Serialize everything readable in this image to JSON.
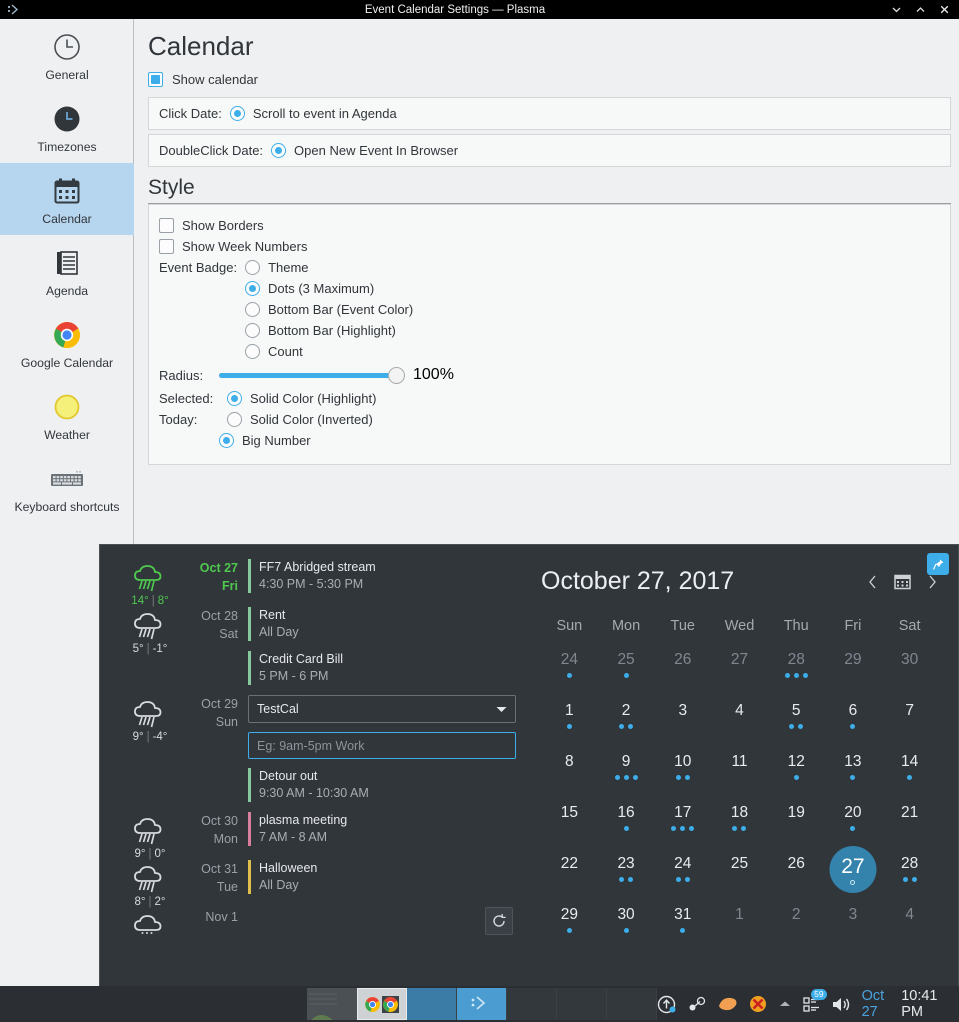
{
  "window": {
    "title": "Event Calendar Settings — Plasma",
    "app_icon": "plasma-icon",
    "minimize_label": "Minimize",
    "maximize_label": "Maximize",
    "close_label": "Close"
  },
  "sidebar": {
    "items": [
      {
        "label": "General",
        "icon": "clock-icon",
        "selected": false
      },
      {
        "label": "Timezones",
        "icon": "timezone-clock-icon",
        "selected": false
      },
      {
        "label": "Calendar",
        "icon": "calendar-icon",
        "selected": true
      },
      {
        "label": "Agenda",
        "icon": "agenda-list-icon",
        "selected": false
      },
      {
        "label": "Google Calendar",
        "icon": "chrome-icon",
        "selected": false
      },
      {
        "label": "Weather",
        "icon": "sun-icon",
        "selected": false
      },
      {
        "label": "Keyboard shortcuts",
        "icon": "keyboard-icon",
        "selected": false
      }
    ]
  },
  "settings": {
    "page_title": "Calendar",
    "show_calendar": {
      "label": "Show calendar",
      "checked": true
    },
    "click_date": {
      "label": "Click Date:",
      "option": "Scroll to event in Agenda",
      "selected": true
    },
    "doubleclick_date": {
      "label": "DoubleClick Date:",
      "option": "Open New Event In Browser",
      "selected": true
    },
    "style_title": "Style",
    "show_borders": {
      "label": "Show Borders",
      "checked": false
    },
    "show_week_numbers": {
      "label": "Show Week Numbers",
      "checked": false
    },
    "event_badge": {
      "label": "Event Badge:",
      "options": [
        {
          "label": "Theme",
          "selected": false
        },
        {
          "label": "Dots (3 Maximum)",
          "selected": true
        },
        {
          "label": "Bottom Bar (Event Color)",
          "selected": false
        },
        {
          "label": "Bottom Bar (Highlight)",
          "selected": false
        },
        {
          "label": "Count",
          "selected": false
        }
      ]
    },
    "radius": {
      "label": "Radius:",
      "value": "100%",
      "percent": 100
    },
    "selected": {
      "label": "Selected:",
      "option": "Solid Color (Highlight)",
      "selected": true
    },
    "today": {
      "label": "Today:",
      "options": [
        {
          "label": "Solid Color (Inverted)",
          "selected": false
        },
        {
          "label": "Big Number",
          "selected": true
        }
      ]
    }
  },
  "popup": {
    "agenda": {
      "days": [
        {
          "date": "Oct 27",
          "weekday": "Fri",
          "today": true,
          "weather": {
            "icon": "rain-cloud-icon",
            "high": "14°",
            "low": "8°",
            "separator": "|"
          },
          "events": [
            {
              "title": "FF7 Abridged stream",
              "time": "4:30 PM - 5:30 PM",
              "color": "#88c9a0"
            }
          ]
        },
        {
          "date": "Oct 28",
          "weekday": "Sat",
          "today": false,
          "weather": {
            "icon": "rain-cloud-icon",
            "high": "5°",
            "low": "-1°",
            "separator": "|"
          },
          "events": [
            {
              "title": "Rent",
              "time": "All Day",
              "color": "#88c9a0"
            },
            {
              "title": "Credit Card Bill",
              "time": "5 PM - 6 PM",
              "color": "#88c9a0"
            }
          ]
        },
        {
          "date": "Oct 29",
          "weekday": "Sun",
          "today": false,
          "weather": {
            "icon": "rain-cloud-icon",
            "high": "9°",
            "low": "-4°",
            "separator": "|"
          },
          "new_event": {
            "calendar_value": "TestCal",
            "calendar_options": [
              "TestCal"
            ],
            "input_value": "",
            "input_placeholder": "Eg: 9am-5pm Work"
          },
          "events": [
            {
              "title": "Detour out",
              "time": "9:30 AM - 10:30 AM",
              "color": "#88c9a0"
            }
          ]
        },
        {
          "date": "Oct 30",
          "weekday": "Mon",
          "today": false,
          "weather": {
            "icon": "rain-cloud-icon",
            "high": "9°",
            "low": "0°",
            "separator": "|"
          },
          "events": [
            {
              "title": "plasma meeting",
              "time": "7 AM - 8 AM",
              "color": "#d97f9e"
            }
          ]
        },
        {
          "date": "Oct 31",
          "weekday": "Tue",
          "today": false,
          "weather": {
            "icon": "rain-cloud-icon",
            "high": "8°",
            "low": "2°",
            "separator": "|"
          },
          "events": [
            {
              "title": "Halloween",
              "time": "All Day",
              "color": "#e0c04a"
            }
          ]
        },
        {
          "date": "Nov 1",
          "weekday": "",
          "today": false,
          "weather": {
            "icon": "cloud-icon",
            "high": "",
            "low": "",
            "separator": ""
          },
          "events": []
        }
      ],
      "reload_button": "reload-icon"
    },
    "calendar": {
      "title": "October 27, 2017",
      "prev_label": "‹",
      "next_label": "›",
      "month_picker_icon": "calendar-icon",
      "pin_icon": "pin-icon",
      "day_headers": [
        "Sun",
        "Mon",
        "Tue",
        "Wed",
        "Thu",
        "Fri",
        "Sat"
      ],
      "weeks": [
        [
          {
            "day": "24",
            "out": true,
            "today": false,
            "dots": 1
          },
          {
            "day": "25",
            "out": true,
            "today": false,
            "dots": 1
          },
          {
            "day": "26",
            "out": true,
            "today": false,
            "dots": 0
          },
          {
            "day": "27",
            "out": true,
            "today": false,
            "dots": 0
          },
          {
            "day": "28",
            "out": true,
            "today": false,
            "dots": 3
          },
          {
            "day": "29",
            "out": true,
            "today": false,
            "dots": 0
          },
          {
            "day": "30",
            "out": true,
            "today": false,
            "dots": 0
          }
        ],
        [
          {
            "day": "1",
            "out": false,
            "today": false,
            "dots": 1
          },
          {
            "day": "2",
            "out": false,
            "today": false,
            "dots": 2
          },
          {
            "day": "3",
            "out": false,
            "today": false,
            "dots": 0
          },
          {
            "day": "4",
            "out": false,
            "today": false,
            "dots": 0
          },
          {
            "day": "5",
            "out": false,
            "today": false,
            "dots": 2
          },
          {
            "day": "6",
            "out": false,
            "today": false,
            "dots": 1
          },
          {
            "day": "7",
            "out": false,
            "today": false,
            "dots": 0
          }
        ],
        [
          {
            "day": "8",
            "out": false,
            "today": false,
            "dots": 0
          },
          {
            "day": "9",
            "out": false,
            "today": false,
            "dots": 3
          },
          {
            "day": "10",
            "out": false,
            "today": false,
            "dots": 2
          },
          {
            "day": "11",
            "out": false,
            "today": false,
            "dots": 0
          },
          {
            "day": "12",
            "out": false,
            "today": false,
            "dots": 1
          },
          {
            "day": "13",
            "out": false,
            "today": false,
            "dots": 1
          },
          {
            "day": "14",
            "out": false,
            "today": false,
            "dots": 1
          }
        ],
        [
          {
            "day": "15",
            "out": false,
            "today": false,
            "dots": 0
          },
          {
            "day": "16",
            "out": false,
            "today": false,
            "dots": 1
          },
          {
            "day": "17",
            "out": false,
            "today": false,
            "dots": 3
          },
          {
            "day": "18",
            "out": false,
            "today": false,
            "dots": 2
          },
          {
            "day": "19",
            "out": false,
            "today": false,
            "dots": 0
          },
          {
            "day": "20",
            "out": false,
            "today": false,
            "dots": 1
          },
          {
            "day": "21",
            "out": false,
            "today": false,
            "dots": 0
          }
        ],
        [
          {
            "day": "22",
            "out": false,
            "today": false,
            "dots": 0
          },
          {
            "day": "23",
            "out": false,
            "today": false,
            "dots": 2
          },
          {
            "day": "24",
            "out": false,
            "today": false,
            "dots": 2
          },
          {
            "day": "25",
            "out": false,
            "today": false,
            "dots": 0
          },
          {
            "day": "26",
            "out": false,
            "today": false,
            "dots": 0
          },
          {
            "day": "27",
            "out": false,
            "today": true,
            "dots": 1
          },
          {
            "day": "28",
            "out": false,
            "today": false,
            "dots": 2
          }
        ],
        [
          {
            "day": "29",
            "out": false,
            "today": false,
            "dots": 1
          },
          {
            "day": "30",
            "out": false,
            "today": false,
            "dots": 1
          },
          {
            "day": "31",
            "out": false,
            "today": false,
            "dots": 1
          },
          {
            "day": "1",
            "out": true,
            "today": false,
            "dots": 0
          },
          {
            "day": "2",
            "out": true,
            "today": false,
            "dots": 0
          },
          {
            "day": "3",
            "out": true,
            "today": false,
            "dots": 0
          },
          {
            "day": "4",
            "out": true,
            "today": false,
            "dots": 0
          }
        ]
      ]
    }
  },
  "taskbar": {
    "tasks": [
      {
        "name": "desktop-preview",
        "kind": "thumb"
      },
      {
        "name": "chrome-window",
        "kind": "chrome"
      },
      {
        "name": "plasma-window-a",
        "kind": "plasma-a"
      },
      {
        "name": "plasma-window-b",
        "kind": "plasma-b"
      },
      {
        "name": "empty-slot-1",
        "kind": "empty"
      },
      {
        "name": "empty-slot-2",
        "kind": "empty"
      },
      {
        "name": "empty-slot-3",
        "kind": "empty"
      }
    ],
    "tray": [
      {
        "name": "updates-icon"
      },
      {
        "name": "steam-icon"
      },
      {
        "name": "clementine-icon"
      },
      {
        "name": "x-app-icon"
      },
      {
        "name": "show-hidden-icon"
      },
      {
        "name": "notifications-icon",
        "badge": "59"
      },
      {
        "name": "volume-icon"
      }
    ],
    "clock": {
      "date": "Oct 27",
      "time": "10:41 PM"
    }
  },
  "colors": {
    "accent": "#3daee9",
    "highlight": "#3383ad",
    "selection_bg": "#b6d5ef",
    "popup_bg": "#31363b",
    "window_bg": "#eff0f1",
    "today_green": "#4ec94e"
  }
}
